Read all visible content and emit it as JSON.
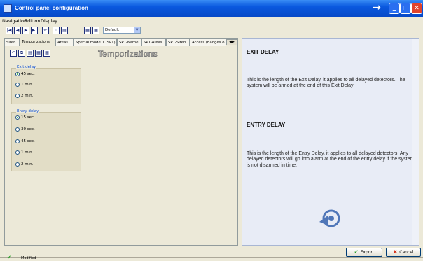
{
  "window": {
    "title": "Control panel configuration"
  },
  "menu": [
    "Navigation",
    "Edition",
    "Display"
  ],
  "toolbar": {
    "profile_value": "Default"
  },
  "tabs": [
    "Siren",
    "Temporizations",
    "Areas",
    "Special mode 1 (SP1)",
    "SP1-Name",
    "SP1-Areas",
    "SP1-Siren",
    "Access (Badges o"
  ],
  "active_tab": "Temporizations",
  "panel": {
    "heading": "Temporizations",
    "exit_delay": {
      "title": "Exit delay",
      "options": [
        "45 sec.",
        "1 min.",
        "2 min."
      ],
      "selected": "45 sec."
    },
    "entry_delay": {
      "title": "Entry delay",
      "options": [
        "15 sec.",
        "30 sec.",
        "45 sec.",
        "1 min.",
        "2 min."
      ],
      "selected": "15 sec."
    }
  },
  "help": {
    "exit_title": "EXIT DELAY",
    "exit_text": "This is the length of the Exit Delay, it applies to all delayed detectors. The system will be armed at the end of this Exit Delay",
    "entry_title": "ENTRY DELAY",
    "entry_text": "This is the length of the Entry Delay, it applies to all delayed detectors. Any delayed detectors will go into alarm at the end of the entry delay if the system is not disarmed in time."
  },
  "buttons": {
    "export": "Export",
    "cancel": "Cancel"
  },
  "status": {
    "text": "Modified"
  },
  "colors": {
    "title_bar": "#0a58df",
    "group_title": "#0046d5",
    "help_bg": "#e8ecf6"
  }
}
